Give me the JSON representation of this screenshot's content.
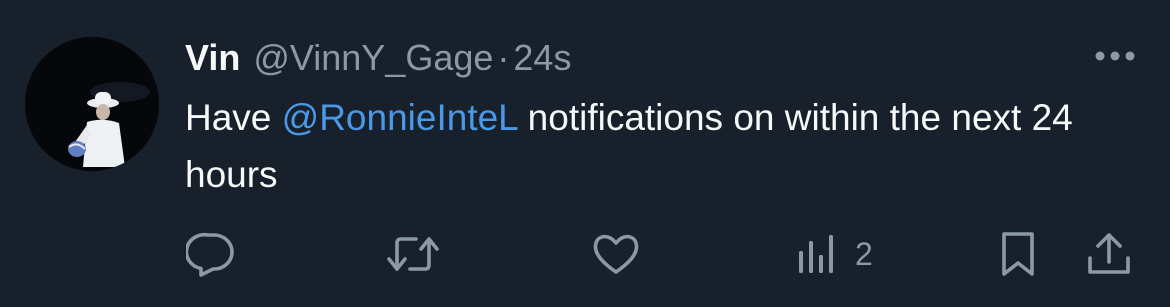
{
  "tweet": {
    "author_name": "Vin",
    "handle": "@VinnY_Gage",
    "separator": "·",
    "timestamp": "24s",
    "text_before": "Have ",
    "mention": "@RonnieInteL",
    "text_after": " notifications on within the next 24 hours"
  },
  "actions": {
    "reply_icon": "speech-bubble-icon",
    "retweet_icon": "retweet-icon",
    "like_icon": "heart-icon",
    "views_icon": "bar-chart-icon",
    "views_count": "2",
    "bookmark_icon": "bookmark-icon",
    "share_icon": "share-upload-icon",
    "more_icon": "ellipsis-icon"
  },
  "colors": {
    "background": "#17202b",
    "primary_text": "#f7f9f9",
    "secondary_text": "#8b98a5",
    "link": "#4a99e9"
  }
}
